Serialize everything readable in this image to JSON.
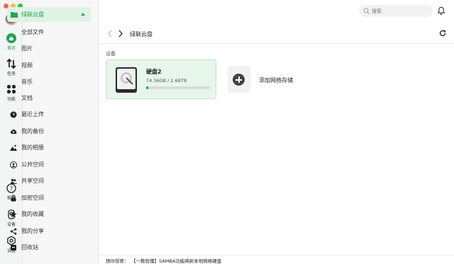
{
  "rail": {
    "home_label": "首页",
    "tasks_label": "任务",
    "functions_label": "功能",
    "help_label": "帮助",
    "device_label": "设备",
    "settings_label": "设置"
  },
  "sidebar": {
    "header": "绿联云盘",
    "sub_items": [
      "全部文件",
      "图片",
      "视频",
      "音乐",
      "文档"
    ],
    "nav_items": [
      "最近上传",
      "我的备份",
      "我的相册",
      "公共空间",
      "共享空间",
      "加密空间",
      "我的收藏",
      "我的分享",
      "回收站"
    ]
  },
  "search": {
    "placeholder": "搜索"
  },
  "toolbar": {
    "breadcrumb": "绿联云盘"
  },
  "main": {
    "section_title": "设备",
    "disk": {
      "name": "硬盘2",
      "capacity": "74.36GB / 2.68TB",
      "used_fraction": 0.028
    },
    "add_storage_label": "添加网络存储"
  },
  "footer": {
    "prefix": "猜你想要：",
    "link": "【一教就懂】SAMBA功能映射本地网络硬盘"
  },
  "colors": {
    "accent": "#23a455",
    "accent_bg": "#e7f6ea"
  }
}
